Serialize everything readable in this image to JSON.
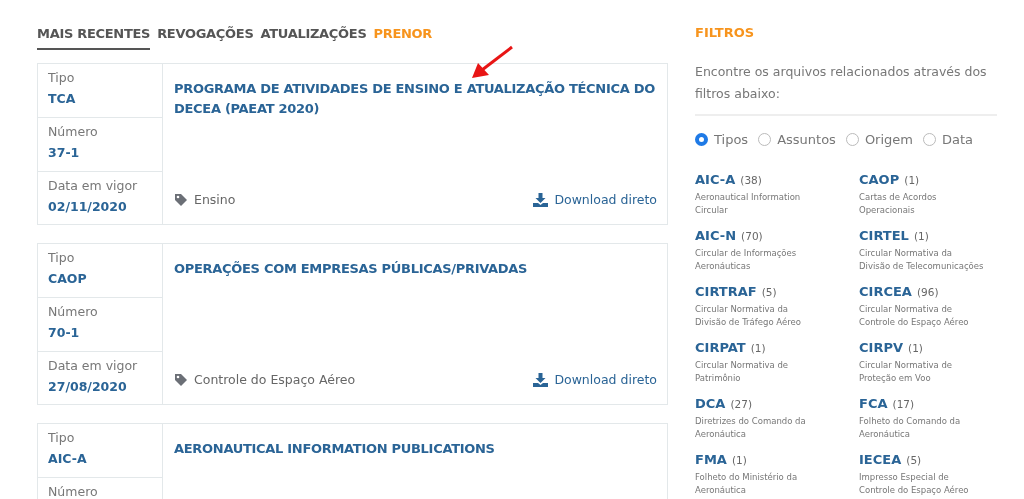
{
  "tabs": [
    {
      "label": "MAIS RECENTES",
      "selected": true,
      "accent": false
    },
    {
      "label": "REVOGAÇÕES",
      "selected": false,
      "accent": false
    },
    {
      "label": "ATUALIZAÇÕES",
      "selected": false,
      "accent": false
    },
    {
      "label": "PRENOR",
      "selected": false,
      "accent": true
    }
  ],
  "documents": [
    {
      "fields": [
        {
          "label": "Tipo",
          "value": "TCA"
        },
        {
          "label": "Número",
          "value": "37-1"
        },
        {
          "label": "Data em vigor",
          "value": "02/11/2020"
        }
      ],
      "title": "PROGRAMA DE ATIVIDADES DE ENSINO E ATUALIZAÇÃO TÉCNICA DO DECEA (PAEAT 2020)",
      "tag": "Ensino",
      "download": "Download direto"
    },
    {
      "fields": [
        {
          "label": "Tipo",
          "value": "CAOP"
        },
        {
          "label": "Número",
          "value": "70-1"
        },
        {
          "label": "Data em vigor",
          "value": "27/08/2020"
        }
      ],
      "title": "OPERAÇÕES COM EMPRESAS PÚBLICAS/PRIVADAS",
      "tag": "Controle do Espaço Aéreo",
      "download": "Download direto"
    },
    {
      "fields": [
        {
          "label": "Tipo",
          "value": "AIC-A"
        },
        {
          "label": "Número"
        }
      ],
      "title": "AERONAUTICAL INFORMATION PUBLICATIONS"
    }
  ],
  "filters": {
    "title": "FILTROS",
    "description": "Encontre os arquivos relacionados através dos filtros abaixo:",
    "options": [
      {
        "label": "Tipos",
        "selected": true
      },
      {
        "label": "Assuntos",
        "selected": false
      },
      {
        "label": "Origem",
        "selected": false
      },
      {
        "label": "Data",
        "selected": false
      }
    ],
    "types": [
      {
        "code": "AIC-A",
        "count": "(38)",
        "description": "Aeronautical Information Circular"
      },
      {
        "code": "CAOP",
        "count": "(1)",
        "description": "Cartas de Acordos Operacionais"
      },
      {
        "code": "AIC-N",
        "count": "(70)",
        "description": "Circular de Informações Aeronáuticas"
      },
      {
        "code": "CIRTEL",
        "count": "(1)",
        "description": "Circular Normativa da Divisão de Telecomunicações"
      },
      {
        "code": "CIRTRAF",
        "count": "(5)",
        "description": "Circular Normativa da Divisão de Tráfego Aéreo"
      },
      {
        "code": "CIRCEA",
        "count": "(96)",
        "description": "Circular Normativa de Controle do Espaço Aéreo"
      },
      {
        "code": "CIRPAT",
        "count": "(1)",
        "description": "Circular Normativa de Patrimônio"
      },
      {
        "code": "CIRPV",
        "count": "(1)",
        "description": "Circular Normativa de Proteção em Voo"
      },
      {
        "code": "DCA",
        "count": "(27)",
        "description": "Diretrizes do Comando da Aeronáutica"
      },
      {
        "code": "FCA",
        "count": "(17)",
        "description": "Folheto do Comando da Aeronáutica"
      },
      {
        "code": "FMA",
        "count": "(1)",
        "description": "Folheto do Ministério da Aeronáutica"
      },
      {
        "code": "IECEA",
        "count": "(5)",
        "description": "Impresso Especial de Controle do Espaço Aéreo"
      }
    ]
  }
}
